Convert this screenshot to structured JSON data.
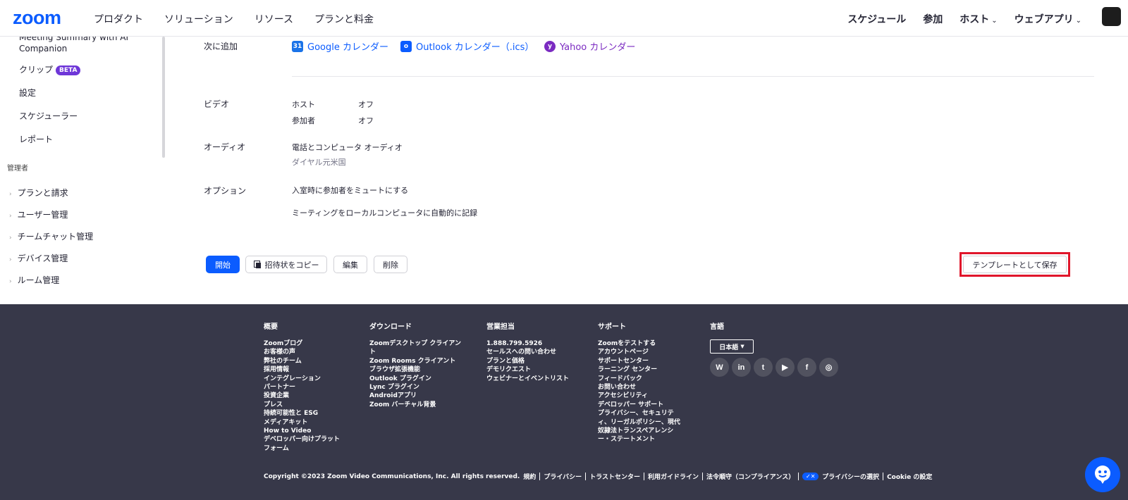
{
  "header": {
    "logo": "zoom",
    "nav_left": [
      "プロダクト",
      "ソリューション",
      "リソース",
      "プランと料金"
    ],
    "nav_right": {
      "schedule": "スケジュール",
      "join": "参加",
      "host": "ホスト",
      "web_app": "ウェブアプリ"
    }
  },
  "sidebar": {
    "items": [
      {
        "label": "Meeting Summary with AI Companion"
      },
      {
        "label": "クリップ",
        "badge": "BETA"
      },
      {
        "label": "設定"
      },
      {
        "label": "スケジューラー"
      },
      {
        "label": "レポート"
      }
    ],
    "admin_section": "管理者",
    "admin_items": [
      "プランと請求",
      "ユーザー管理",
      "チームチャット管理",
      "デバイス管理",
      "ルーム管理"
    ]
  },
  "meeting": {
    "add_to_label": "次に追加",
    "calendars": [
      {
        "label": "Google カレンダー",
        "icon": "google-calendar-icon",
        "color": "#0b5cff"
      },
      {
        "label": "Outlook カレンダー（.ics）",
        "icon": "outlook-icon",
        "color": "#0b5cff"
      },
      {
        "label": "Yahoo カレンダー",
        "icon": "yahoo-icon",
        "color": "#7b2bc1"
      }
    ],
    "video_label": "ビデオ",
    "video_host_label": "ホスト",
    "video_host_value": "オフ",
    "video_participant_label": "参加者",
    "video_participant_value": "オフ",
    "audio_label": "オーディオ",
    "audio_value": "電話とコンピュータ オーディオ",
    "dial_in": "ダイヤル元米国",
    "options_label": "オプション",
    "option1": "入室時に参加者をミュートにする",
    "option2": "ミーティングをローカルコンピュータに自動的に記録"
  },
  "actions": {
    "start": "開始",
    "copy_invite": "招待状をコピー",
    "edit": "編集",
    "delete": "削除",
    "save_template": "テンプレートとして保存"
  },
  "footer": {
    "about": {
      "title": "概要",
      "links": [
        "Zoomブログ",
        "お客様の声",
        "弊社のチーム",
        "採用情報",
        "インテグレーション",
        "パートナー",
        "投資企業",
        "プレス",
        "持続可能性と ESG",
        "メディアキット",
        "How to Video",
        "デベロッパー向けプラット",
        "フォーム"
      ]
    },
    "download": {
      "title": "ダウンロード",
      "links": [
        "Zoomデスクトップ クライアン",
        "ト",
        "Zoom Rooms クライアント",
        "ブラウザ拡張機能",
        "Outlook プラグイン",
        "Lync プラグイン",
        "Androidアプリ",
        "Zoom バーチャル背景"
      ]
    },
    "sales": {
      "title": "営業担当",
      "links": [
        "1.888.799.5926",
        "セールスへの問い合わせ",
        "プランと価格",
        "デモリクエスト",
        "ウェビナーとイベントリスト"
      ]
    },
    "support": {
      "title": "サポート",
      "links": [
        "Zoomをテストする",
        "アカウントページ",
        "サポートセンター",
        "ラーニング センター",
        "フィードバック",
        "お問い合わせ",
        "アクセシビリティ",
        "デベロッパー サポート",
        "プライバシー、セキュリテ",
        "ィ、リーガルポリシー、現代",
        "奴隷法トランスペアレンシ",
        "ー・ステートメント"
      ]
    },
    "language": {
      "title": "言語",
      "selected": "日本語"
    },
    "socials": [
      "wordpress-icon",
      "linkedin-icon",
      "twitter-icon",
      "youtube-icon",
      "facebook-icon",
      "instagram-icon"
    ],
    "copyright": "Copyright ©2023 Zoom Video Communications, Inc. All rights reserved.",
    "legal_links": [
      "規約",
      "プライバシー",
      "トラストセンター",
      "利用ガイドライン",
      "法令順守（コンプライアンス）"
    ],
    "privacy_choice": "プライバシーの選択",
    "cookie": "Cookie の設定"
  }
}
